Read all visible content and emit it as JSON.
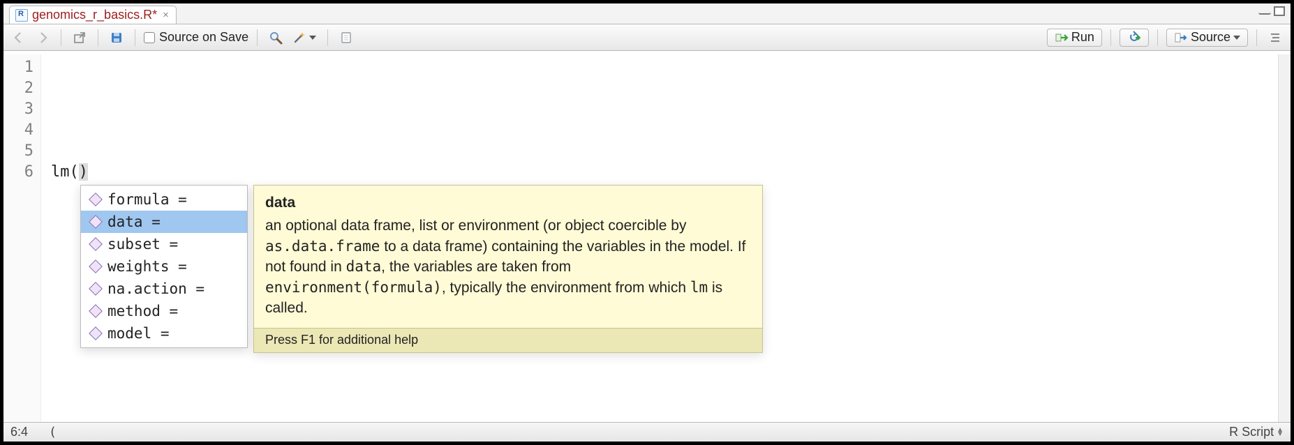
{
  "tab": {
    "filename": "genomics_r_basics.R*",
    "close_glyph": "×"
  },
  "toolbar": {
    "source_on_save": "Source on Save",
    "run": "Run",
    "source": "Source"
  },
  "editor": {
    "lines": [
      "1",
      "2",
      "3",
      "4",
      "5",
      "6"
    ],
    "code_line6_fn": "lm",
    "code_line6_open": "(",
    "code_line6_close": ")"
  },
  "autocomplete": {
    "selected_index": 1,
    "items": [
      "formula = ",
      "data = ",
      "subset = ",
      "weights = ",
      "na.action = ",
      "method = ",
      "model = "
    ]
  },
  "tooltip": {
    "title": "data",
    "p1a": "an optional data frame, list or environment (or object coercible by ",
    "p1_code1": "as.data.frame",
    "p1b": " to a data frame) containing the variables in the model. If not found in ",
    "p1_code2": "data",
    "p1c": ", the variables are taken from ",
    "p1_code3": "environment(formula)",
    "p1d": ", typically the environment from which ",
    "p1_code4": "lm",
    "p1e": " is called.",
    "footer": "Press F1 for additional help"
  },
  "status": {
    "pos": "6:4",
    "context": "(",
    "lang": "R Script"
  }
}
